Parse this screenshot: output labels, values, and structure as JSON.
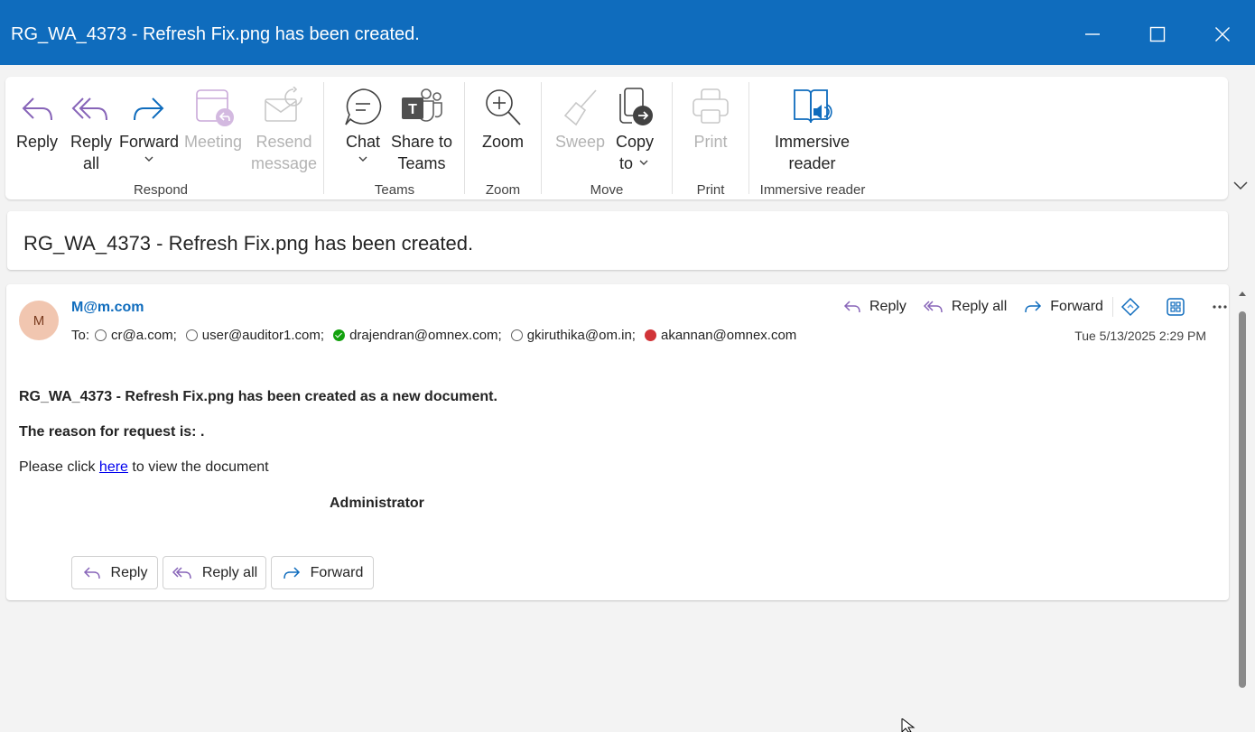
{
  "window": {
    "title": "RG_WA_4373 - Refresh Fix.png has been created."
  },
  "ribbon": {
    "groups": [
      {
        "name": "Respond",
        "buttons": [
          {
            "label": "Reply",
            "label2": "",
            "enabled": true
          },
          {
            "label": "Reply",
            "label2": "all",
            "enabled": true
          },
          {
            "label": "Forward",
            "label2": "",
            "enabled": true
          },
          {
            "label": "Meeting",
            "label2": "",
            "enabled": false
          },
          {
            "label": "Resend",
            "label2": "message",
            "enabled": false
          }
        ]
      },
      {
        "name": "Teams",
        "buttons": [
          {
            "label": "Chat",
            "label2": "",
            "enabled": true
          },
          {
            "label": "Share to",
            "label2": "Teams",
            "enabled": true
          }
        ]
      },
      {
        "name": "Zoom",
        "buttons": [
          {
            "label": "Zoom",
            "label2": "",
            "enabled": true
          }
        ]
      },
      {
        "name": "Move",
        "buttons": [
          {
            "label": "Sweep",
            "label2": "",
            "enabled": false
          },
          {
            "label": "Copy",
            "label2": "to",
            "enabled": true
          }
        ]
      },
      {
        "name": "Print",
        "buttons": [
          {
            "label": "Print",
            "label2": "",
            "enabled": false
          }
        ]
      },
      {
        "name": "Immersive reader",
        "buttons": [
          {
            "label": "Immersive",
            "label2": "reader",
            "enabled": true
          }
        ]
      }
    ]
  },
  "message": {
    "subject": "RG_WA_4373 - Refresh Fix.png has been created.",
    "avatar_initial": "M",
    "sender": "M@m.com",
    "to_label": "To:",
    "recipients": [
      {
        "email": "cr@a.com;",
        "presence": "offline"
      },
      {
        "email": "user@auditor1.com;",
        "presence": "offline"
      },
      {
        "email": "drajendran@omnex.com;",
        "presence": "available"
      },
      {
        "email": "gkiruthika@om.in;",
        "presence": "offline"
      },
      {
        "email": "akannan@omnex.com",
        "presence": "busy"
      }
    ],
    "date": "Tue 5/13/2025 2:29 PM",
    "header_actions": {
      "reply": "Reply",
      "reply_all": "Reply all",
      "forward": "Forward"
    },
    "body": {
      "line1": "RG_WA_4373 - Refresh Fix.png has been created as a new document.",
      "line2": "The reason for request is: .",
      "line3_pre": "Please click ",
      "line3_link": "here",
      "line3_post": " to view the document",
      "signature": "Administrator"
    },
    "footer_actions": {
      "reply": "Reply",
      "reply_all": "Reply all",
      "forward": "Forward"
    }
  },
  "colors": {
    "titlebar": "#0f6cbd",
    "reply_icon": "#8764b8",
    "forward_icon": "#0f6cbd",
    "presence_available": "#13a10e",
    "presence_busy": "#d13438"
  }
}
